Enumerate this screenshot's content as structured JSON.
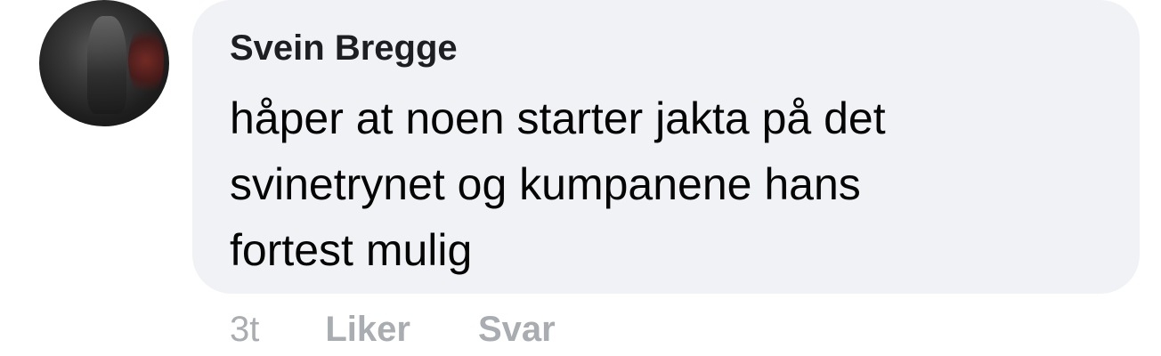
{
  "comment": {
    "author": "Svein Bregge",
    "lines": [
      "håper at noen starter jakta på det",
      "svinetrynet og kumpanene hans",
      "fortest mulig"
    ],
    "time": "3t",
    "like_label": "Liker",
    "reply_label": "Svar"
  },
  "colors": {
    "bubble_bg": "#f0f2f5",
    "text": "#050505",
    "meta": "#a9acb0"
  }
}
